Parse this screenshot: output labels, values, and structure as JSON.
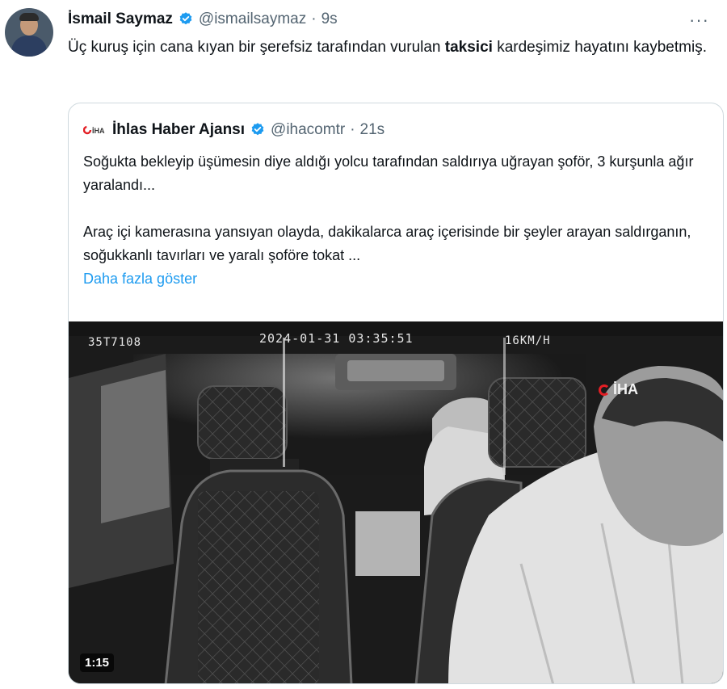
{
  "tweet": {
    "author_name": "İsmail Saymaz",
    "handle": "@ismailsaymaz",
    "separator": "·",
    "time": "9s",
    "more_label": "···",
    "text_before": "Üç kuruş için cana kıyan bir şerefsiz tarafından vurulan ",
    "text_bold": "taksici",
    "text_after": " kardeşimiz hayatını kaybetmiş."
  },
  "quote": {
    "author_name": "İhlas Haber Ajansı",
    "handle": "@ihacomtr",
    "separator": "·",
    "time": "21s",
    "paragraph1": "Soğukta bekleyip üşümesin diye aldığı yolcu tarafından saldırıya uğrayan şoför, 3 kurşunla ağır yaralandı...",
    "paragraph2": "Araç içi kamerasına yansıyan olayda, dakikalarca araç içerisinde bir şeyler arayan saldırganın, soğukkanlı tavırları ve yaralı şoföre tokat ...",
    "show_more": "Daha fazla göster",
    "logo_text": "İHA"
  },
  "media": {
    "camera_code": "35T7108",
    "timestamp": "2024-01-31 03:35:51",
    "speed": "16KM/H",
    "watermark": "İHA",
    "duration": "1:15"
  },
  "colors": {
    "accent": "#1d9bf0",
    "verified": "#1d9bf0",
    "secondary_text": "#536471",
    "border": "#cfd9de",
    "brand_red": "#e31e24"
  },
  "icons": {
    "verified": "verified-badge-icon",
    "more": "more-options-icon"
  }
}
